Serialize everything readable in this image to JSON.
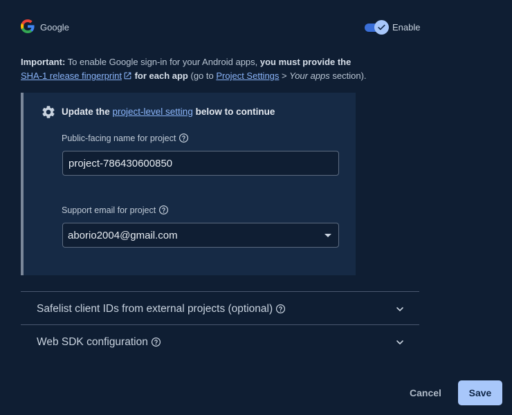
{
  "provider": {
    "name": "Google",
    "toggle_label": "Enable",
    "enabled": true
  },
  "important": {
    "lead": "Important:",
    "text1": " To enable Google sign-in for your Android apps, ",
    "bold1": "you must provide the",
    "link1": "SHA-1 release fingerprint",
    "bold2": " for each app",
    "text2": " (go to ",
    "link2": "Project Settings",
    "text3": " > ",
    "italic1": "Your apps",
    "text4": " section)."
  },
  "panel": {
    "heading_prefix": "Update the ",
    "heading_link": "project-level setting",
    "heading_suffix": " below to continue",
    "public_name_label": "Public-facing name for project",
    "public_name_value": "project-786430600850",
    "support_email_label": "Support email for project",
    "support_email_value": "aborio2004@gmail.com"
  },
  "sections": {
    "safelist_title": "Safelist client IDs from external projects (optional)",
    "websdk_title": "Web SDK configuration"
  },
  "footer": {
    "cancel_label": "Cancel",
    "save_label": "Save"
  },
  "colors": {
    "background": "#0f1e33",
    "panel": "#162a45",
    "link": "#8ab4f8",
    "primary_button": "#a8c7fa",
    "toggle_track": "#3a6fd8"
  },
  "icons": {
    "provider": "google-g-icon",
    "toggle_knob": "check-icon",
    "external_link": "external-link-icon",
    "panel": "gear-icon",
    "help": "help-circle-icon",
    "dropdown": "caret-down-icon",
    "expand": "chevron-down-icon"
  }
}
